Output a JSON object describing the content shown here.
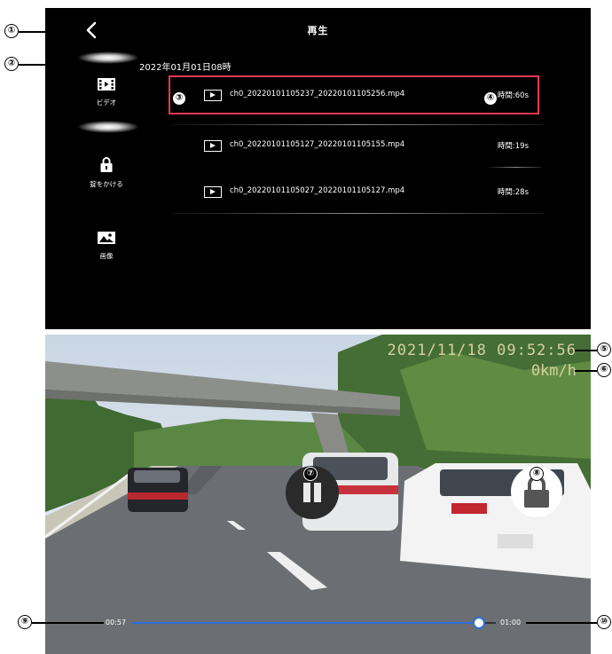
{
  "header": {
    "title": "再生",
    "back_icon": "chevron-left-icon"
  },
  "date_header": "2022年01月01日08時",
  "sidebar": {
    "items": [
      {
        "label": "ビデオ",
        "icon": "film-icon"
      },
      {
        "label": "錠をかける",
        "icon": "lock-icon"
      },
      {
        "label": "画像",
        "icon": "image-icon"
      }
    ]
  },
  "files": [
    {
      "name": "ch0_20220101105237_20220101105256.mp4",
      "duration": "時間:60s",
      "selected": true
    },
    {
      "name": "ch0_20220101105127_20220101105155.mp4",
      "duration": "時間:19s",
      "selected": false
    },
    {
      "name": "ch0_20220101105027_20220101105127.mp4",
      "duration": "時間:28s",
      "selected": false
    }
  ],
  "video": {
    "timestamp": "2021/11/18 09:52:56",
    "speed": "0km/h",
    "current_time": "00:57",
    "total_time": "01:00",
    "progress": 0.95,
    "pause_icon": "pause-icon",
    "lock_icon": "lock-icon",
    "accent_color": "#2f6ed8"
  },
  "callouts": [
    "①",
    "②",
    "③",
    "④",
    "⑤",
    "⑥",
    "⑦",
    "⑧",
    "⑨",
    "⑩"
  ],
  "colors": {
    "highlight": "#e63950"
  }
}
